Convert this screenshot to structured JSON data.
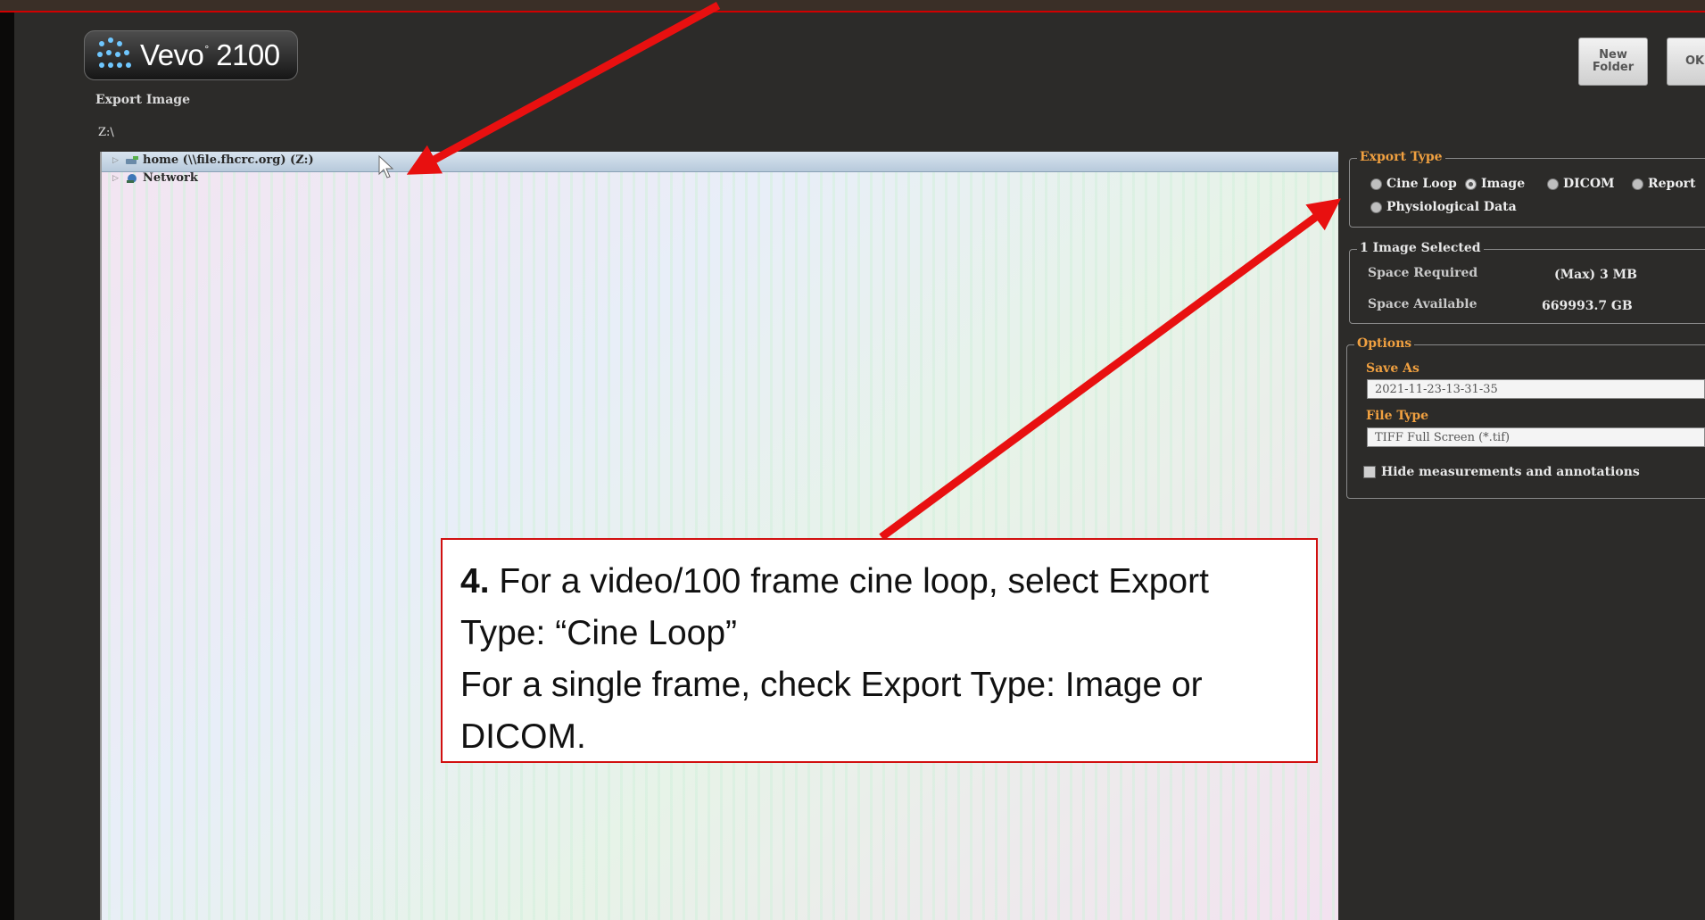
{
  "app": {
    "name": "Vevo",
    "version": "2100"
  },
  "page_title": "Export Image",
  "current_path": "Z:\\",
  "toolbar": {
    "new_folder_label": "New Folder",
    "ok_label": "OK"
  },
  "tree": [
    {
      "label": "home (\\\\file.fhcrc.org) (Z:)",
      "icon": "network-drive-icon"
    },
    {
      "label": "Network",
      "icon": "network-icon"
    }
  ],
  "export_type": {
    "legend": "Export Type",
    "options": [
      "Cine Loop",
      "Image",
      "DICOM",
      "Report",
      "Physiological Data"
    ],
    "selected": "Image"
  },
  "selection": {
    "legend": "1 Image Selected",
    "space_required_label": "Space Required",
    "space_required_value": "(Max) 3 MB",
    "space_available_label": "Space Available",
    "space_available_value": "669993.7 GB"
  },
  "options": {
    "legend": "Options",
    "save_as_label": "Save As",
    "save_as_value": "2021-11-23-13-31-35",
    "file_type_label": "File Type",
    "file_type_value": "TIFF Full Screen (*.tif)",
    "hide_label": "Hide measurements and annotations"
  },
  "annotation": {
    "step": "4.",
    "line1": " For a video/100 frame cine loop, select Export Type: “Cine Loop”",
    "line2": "For a single frame, check Export Type: Image or DICOM."
  },
  "colors": {
    "annotation_red": "#d11010",
    "legend_orange": "#f0a040"
  }
}
